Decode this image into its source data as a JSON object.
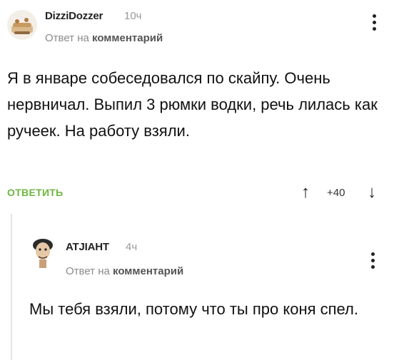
{
  "comments": [
    {
      "author": "DizziDozzer",
      "time": "10ч",
      "reply_prefix": "Ответ на",
      "reply_target": "комментарий",
      "text": "Я в январе собеседовался по скайпу. Очень нервничал. Выпил 3 рюмки водки, речь лилась как ручеек. На работу взяли.",
      "reply_label": "ОТВЕТИТЬ",
      "score": "+40",
      "up_icon": "↑",
      "down_icon": "↓"
    },
    {
      "author": "ATJIAHT",
      "time": "4ч",
      "reply_prefix": "Ответ на",
      "reply_target": "комментарий",
      "text": "Мы тебя взяли, потому что ты про коня спел."
    }
  ]
}
